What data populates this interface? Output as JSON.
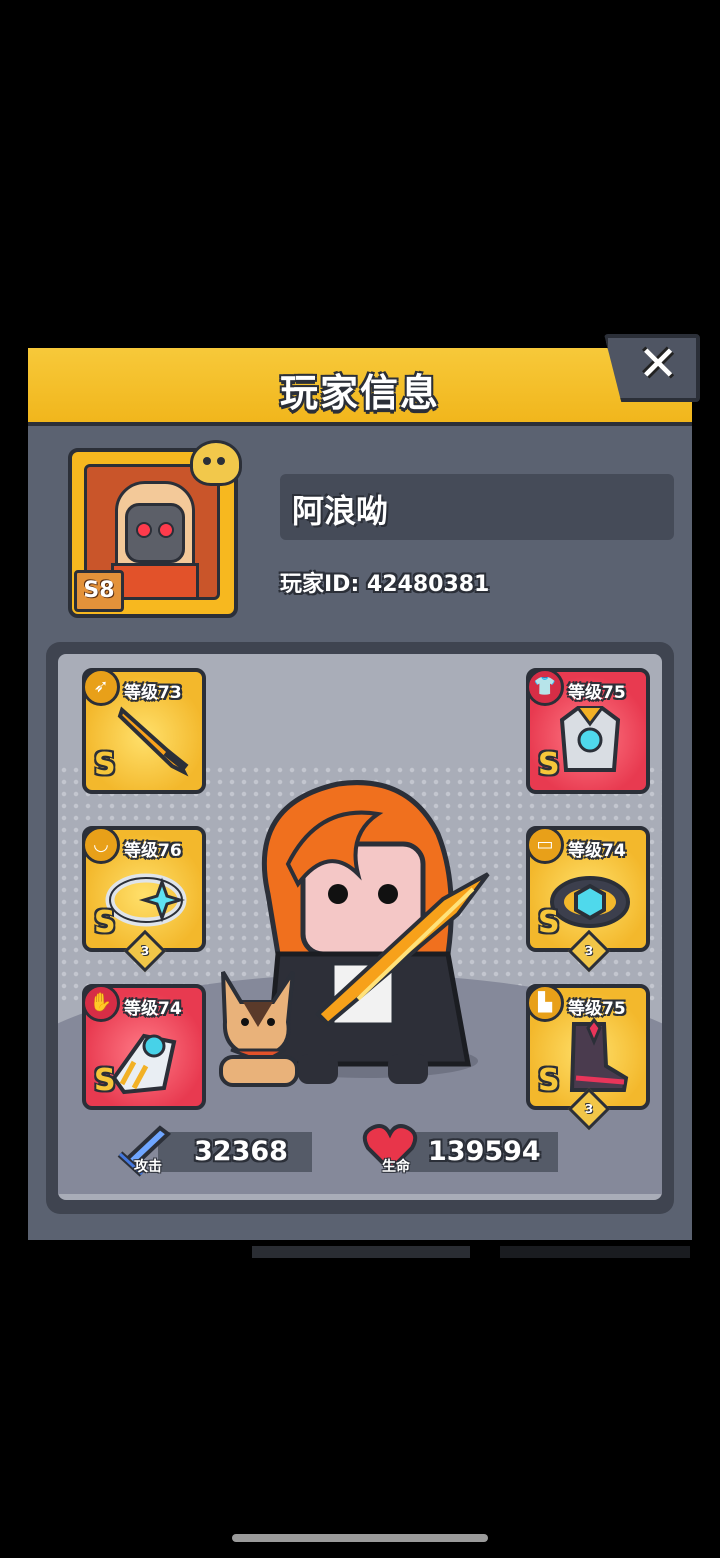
{
  "dialog": {
    "title": "玩家信息",
    "close_symbol": "✕"
  },
  "profile": {
    "name": "阿浪呦",
    "player_id": "玩家ID: 42480381",
    "season_badge": "S8"
  },
  "equipment": {
    "left": [
      {
        "slot": "weapon",
        "icon": "sword-icon",
        "level": "等级73",
        "rank": "S",
        "stars": "",
        "color": "#f3b82c"
      },
      {
        "slot": "necklace",
        "icon": "necklace-icon",
        "level": "等级76",
        "rank": "S",
        "stars": "3",
        "color": "#f3b82c"
      },
      {
        "slot": "gloves",
        "icon": "glove-icon",
        "level": "等级74",
        "rank": "S",
        "stars": "",
        "color": "#e83a50"
      }
    ],
    "right": [
      {
        "slot": "armor",
        "icon": "armor-icon",
        "level": "等级75",
        "rank": "S",
        "stars": "",
        "color": "#e83a50"
      },
      {
        "slot": "belt",
        "icon": "belt-icon",
        "level": "等级74",
        "rank": "S",
        "stars": "3",
        "color": "#f3b82c"
      },
      {
        "slot": "boots",
        "icon": "boot-icon",
        "level": "等级75",
        "rank": "S",
        "stars": "3",
        "color": "#f3b82c"
      }
    ]
  },
  "stats": {
    "attack": {
      "label": "攻击",
      "value": "32368"
    },
    "health": {
      "label": "生命",
      "value": "139594"
    }
  },
  "colors": {
    "title_bar": "#f1b61c",
    "dialog_bg": "#5b6271",
    "panel_bg": "#a9adb8",
    "rank_gold": "#f6c63a"
  }
}
